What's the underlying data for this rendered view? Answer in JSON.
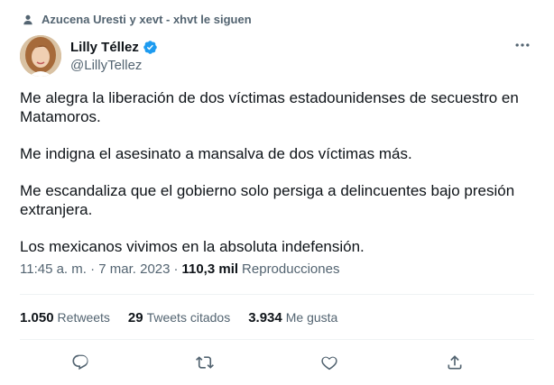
{
  "social_context": {
    "text": "Azucena Uresti y xevt - xhvt le siguen"
  },
  "author": {
    "display_name": "Lilly Téllez",
    "handle": "@LillyTellez",
    "verified": true,
    "verified_color": "#1d9bf0"
  },
  "tweet": {
    "paragraphs": [
      "Me alegra la liberación de dos víctimas estadounidenses de secuestro en Matamoros.",
      "Me indigna el asesinato a mansalva de dos víctimas más.",
      "Me escandaliza que el gobierno solo persiga a delincuentes bajo presión extranjera.",
      "Los mexicanos vivimos en la absoluta indefensión."
    ],
    "timestamp": "11:45 a. m. · 7 mar. 2023",
    "separator": "·",
    "views_count": "110,3 mil",
    "views_label": "Reproducciones"
  },
  "stats": {
    "retweets": {
      "count": "1.050",
      "label": "Retweets"
    },
    "quotes": {
      "count": "29",
      "label": "Tweets citados"
    },
    "likes": {
      "count": "3.934",
      "label": "Me gusta"
    }
  },
  "actions": [
    "reply-icon",
    "retweet-icon",
    "like-icon",
    "share-icon"
  ],
  "colors": {
    "muted": "#536471",
    "text": "#0f1419",
    "divider": "#eff3f4"
  }
}
